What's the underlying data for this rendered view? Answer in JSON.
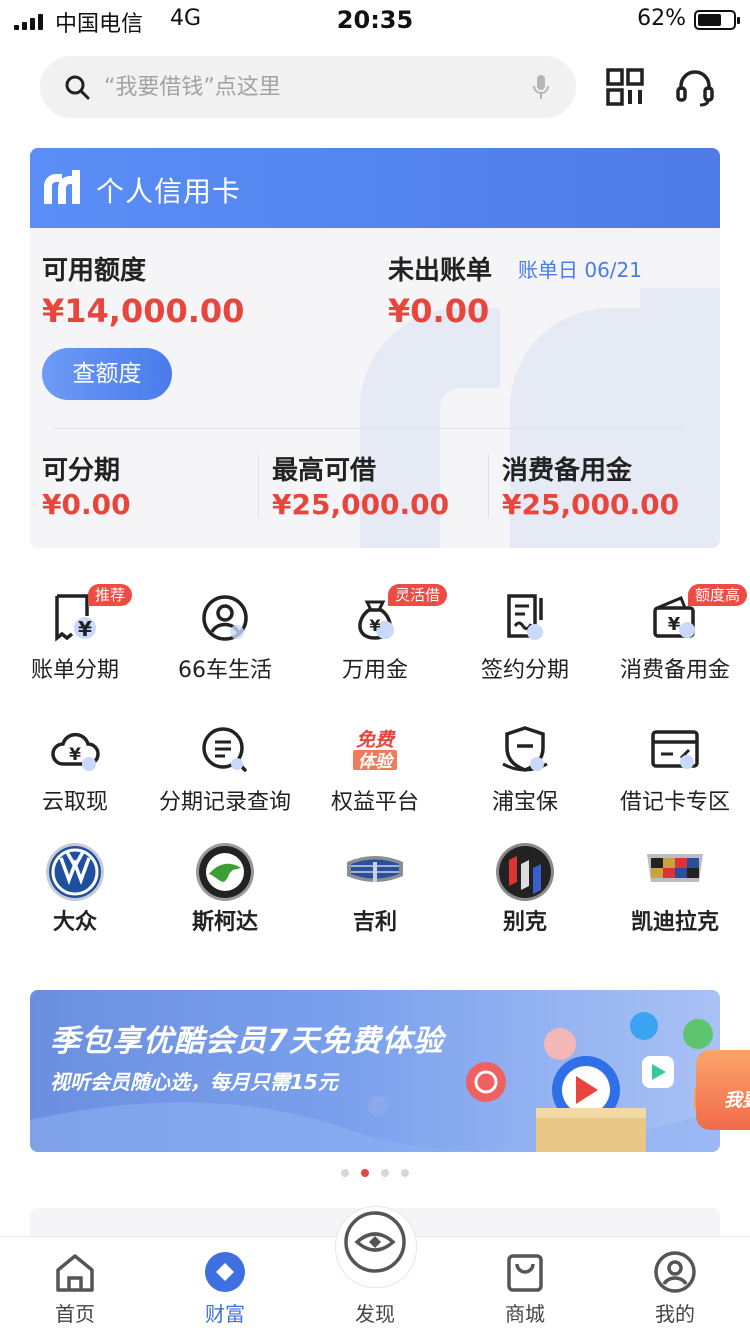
{
  "status_bar": {
    "carrier": "中国电信",
    "network": "4G",
    "time": "20:35",
    "battery": "62%"
  },
  "search": {
    "placeholder": "“我要借钱”点这里"
  },
  "card": {
    "title": "个人信用卡",
    "available_label": "可用额度",
    "available_amount": "¥14,000.00",
    "unbilled_label": "未出账单",
    "bill_date": "账单日 06/21",
    "unbilled_amount": "¥0.00",
    "check_button": "查额度",
    "stats": [
      {
        "label": "可分期",
        "amount": "¥0.00"
      },
      {
        "label": "最高可借",
        "amount": "¥25,000.00"
      },
      {
        "label": "消费备用金",
        "amount": "¥25,000.00"
      }
    ]
  },
  "services": [
    {
      "label": "账单分期",
      "badge": "推荐",
      "icon": "bill-installment-icon"
    },
    {
      "label": "66车生活",
      "badge": "",
      "icon": "user-circle-icon"
    },
    {
      "label": "万用金",
      "badge": "灵活借",
      "icon": "money-bag-icon"
    },
    {
      "label": "签约分期",
      "badge": "",
      "icon": "sign-document-icon"
    },
    {
      "label": "消费备用金",
      "badge": "额度高",
      "icon": "wallet-icon"
    },
    {
      "label": "云取现",
      "badge": "",
      "icon": "cloud-cash-icon"
    },
    {
      "label": "分期记录查询",
      "badge": "",
      "icon": "record-search-icon"
    },
    {
      "label": "权益平台",
      "badge": "",
      "icon": "free-trial-icon",
      "icon_text": [
        "免费",
        "体验"
      ]
    },
    {
      "label": "浦宝保",
      "badge": "",
      "icon": "shield-icon"
    },
    {
      "label": "借记卡专区",
      "badge": "",
      "icon": "debit-card-icon"
    }
  ],
  "brands": [
    {
      "label": "大众",
      "icon": "volkswagen-logo-icon"
    },
    {
      "label": "斯柯达",
      "icon": "skoda-logo-icon"
    },
    {
      "label": "吉利",
      "icon": "geely-logo-icon"
    },
    {
      "label": "别克",
      "icon": "buick-logo-icon"
    },
    {
      "label": "凯迪拉克",
      "icon": "cadillac-logo-icon"
    }
  ],
  "banner": {
    "title": "季包享优酷会员7天免费体验",
    "subtitle": "视听会员随心选，每月只需15元",
    "peek_text": "我要"
  },
  "tabs": [
    {
      "label": "首页",
      "icon": "home-icon",
      "active": false
    },
    {
      "label": "财富",
      "icon": "wealth-diamond-icon",
      "active": true
    },
    {
      "label": "发现",
      "icon": "discover-eye-icon",
      "active": false
    },
    {
      "label": "商城",
      "icon": "shopping-bag-icon",
      "active": false
    },
    {
      "label": "我的",
      "icon": "profile-icon",
      "active": false
    }
  ],
  "colors": {
    "accent": "#4a7bea",
    "amount": "#e8453c",
    "badge": "#ef4b44"
  }
}
